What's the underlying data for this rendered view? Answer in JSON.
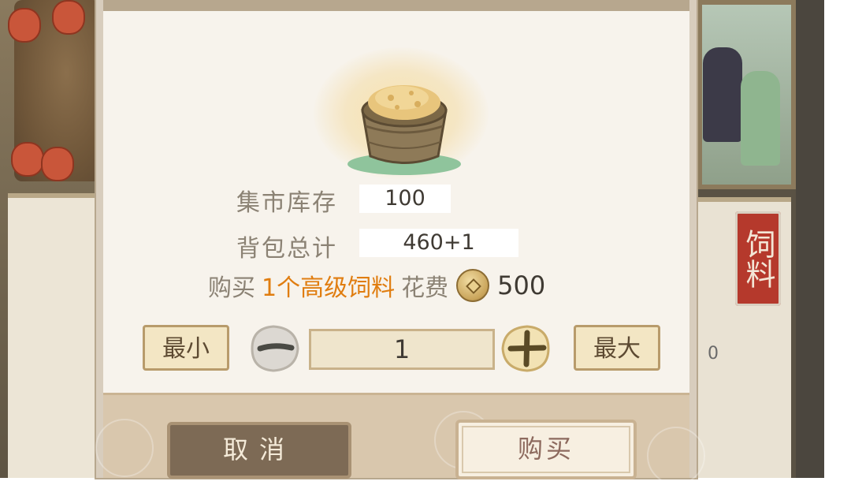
{
  "banner_text": "饲料",
  "side_count": "0",
  "dialog": {
    "item_name_icon": "feed-bucket-icon",
    "market_stock_label": "集市库存",
    "market_stock_value": "100",
    "bag_total_label": "背包总计",
    "bag_total_value": "460+1",
    "price_prefix": "购买",
    "price_count": "1个",
    "price_item": "高级饲料",
    "price_mid": "花费",
    "price_value": "500",
    "min_label": "最小",
    "max_label": "最大",
    "quantity": "1",
    "cancel_label": "取消",
    "buy_label": "购买"
  },
  "colors": {
    "highlight": "#e07d10",
    "dialog_bg": "#f7f3ec",
    "banner": "#b5392c"
  }
}
